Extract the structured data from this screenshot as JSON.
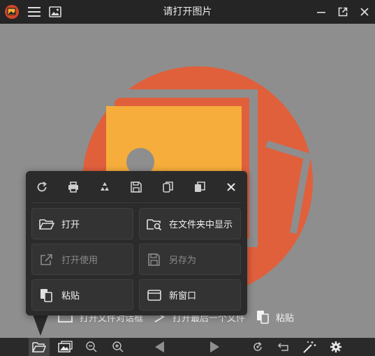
{
  "window": {
    "title": "请打开图片"
  },
  "menu": {
    "toolbar_icons": [
      "refresh-icon",
      "print-icon",
      "recycle-icon",
      "save-icon",
      "copy-icon",
      "copy-file-icon",
      "close-icon"
    ],
    "buttons": [
      {
        "label": "打开",
        "icon": "folder-open-icon",
        "enabled": true
      },
      {
        "label": "在文件夹中显示",
        "icon": "folder-search-icon",
        "enabled": true
      },
      {
        "label": "打开使用",
        "icon": "open-external-icon",
        "enabled": false
      },
      {
        "label": "另存为",
        "icon": "save-as-icon",
        "enabled": false
      },
      {
        "label": "粘贴",
        "icon": "paste-icon",
        "enabled": true
      },
      {
        "label": "新窗口",
        "icon": "new-window-icon",
        "enabled": true
      }
    ]
  },
  "hints": {
    "open_dialog": "打开文件对话框",
    "open_recent": "打开最后一个文件",
    "paste": "粘贴"
  },
  "colors": {
    "accent_orange": "#e0603c",
    "photo_yellow": "#f6ad3b",
    "bar_bg": "#252525",
    "menu_bg": "#2b2b2b"
  }
}
